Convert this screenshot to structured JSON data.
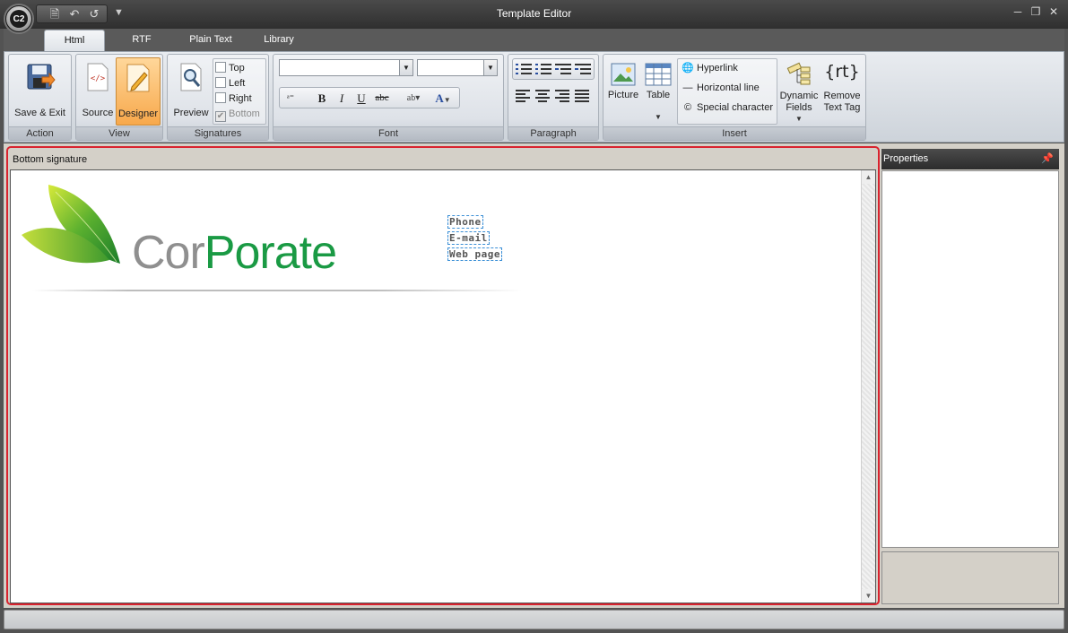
{
  "window": {
    "title": "Template Editor",
    "app_badge": "C2"
  },
  "ribbon_tabs": [
    {
      "label": "Html",
      "active": true
    },
    {
      "label": "RTF",
      "active": false
    },
    {
      "label": "Plain Text",
      "active": false
    },
    {
      "label": "Library",
      "active": false
    }
  ],
  "groups": {
    "action": {
      "label": "Action",
      "save_exit": "Save & Exit"
    },
    "view": {
      "label": "View",
      "source": "Source",
      "designer": "Designer"
    },
    "signatures": {
      "label": "Signatures",
      "preview": "Preview",
      "top": "Top",
      "left": "Left",
      "right": "Right",
      "bottom": "Bottom"
    },
    "font": {
      "label": "Font",
      "font_name": "",
      "font_size": ""
    },
    "paragraph": {
      "label": "Paragraph"
    },
    "insert": {
      "label": "Insert",
      "picture": "Picture",
      "table": "Table",
      "hyperlink": "Hyperlink",
      "horizontal_line": "Horizontal line",
      "special_character": "Special character",
      "dynamic_fields_line1": "Dynamic",
      "dynamic_fields_line2": "Fields",
      "remove_text_tag_icon": "{rt}",
      "remove_text_tag_line1": "Remove",
      "remove_text_tag_line2": "Text Tag"
    }
  },
  "document": {
    "header": "Bottom signature",
    "logo_text_part1": "Cor",
    "logo_text_part2": "Porate",
    "fields": [
      "Phone",
      "E-mail",
      "Web page"
    ]
  },
  "properties": {
    "title": "Properties"
  },
  "colors": {
    "accent_red": "#d9232e",
    "brand_green": "#1a9a44",
    "brand_gray": "#8f8f8f",
    "designer_active": "#f7a84b"
  }
}
